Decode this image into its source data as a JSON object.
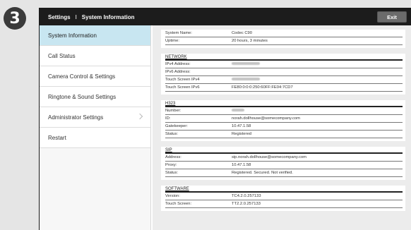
{
  "step_number": "3",
  "titlebar": {
    "title": "Settings",
    "separator": "I",
    "subtitle": "System Information",
    "exit_label": "Exit"
  },
  "sidebar": {
    "items": [
      {
        "label": "System Information",
        "active": true
      },
      {
        "label": "Call Status"
      },
      {
        "label": "Camera Control & Settings"
      },
      {
        "label": "Ringtone & Sound Settings"
      },
      {
        "label": "Administrator Settings"
      },
      {
        "label": "Restart"
      }
    ]
  },
  "system": {
    "rows": [
      {
        "label": "System Name:",
        "value": "Codec C90"
      },
      {
        "label": "Uptime:",
        "value": "20 hours, 3 minutes"
      }
    ]
  },
  "network": {
    "heading": "NETWORK",
    "rows": [
      {
        "label": "IPv4 Address:",
        "value": ""
      },
      {
        "label": "IPv6 Address:",
        "value": ""
      },
      {
        "label": "Touch Screen IPv4",
        "value": ""
      },
      {
        "label": "Touch Screen IPv6",
        "value": "FE80:0:0:0:250:60FF:FE04:7CD7"
      }
    ]
  },
  "h323": {
    "heading": "H323",
    "rows": [
      {
        "label": "Number:",
        "value": ""
      },
      {
        "label": "ID:",
        "value": "norah.dollhouse@somecompany.com"
      },
      {
        "label": "Gatekeeper:",
        "value": "10.47.1.58"
      },
      {
        "label": "Status:",
        "value": "Registered"
      }
    ]
  },
  "sip": {
    "heading": "SIP",
    "rows": [
      {
        "label": "Address:",
        "value": "sip.norah.dollhouse@somecompany.com"
      },
      {
        "label": "Proxy:",
        "value": "10.47.1.58"
      },
      {
        "label": "Status:",
        "value": "Registered. Secured. Not verified."
      }
    ]
  },
  "software": {
    "heading": "SOFTWARE",
    "rows": [
      {
        "label": "Version:",
        "value": "TC4.2.0.257133"
      },
      {
        "label": "Touch Screen:",
        "value": "TT2.2.0.257133"
      }
    ]
  }
}
